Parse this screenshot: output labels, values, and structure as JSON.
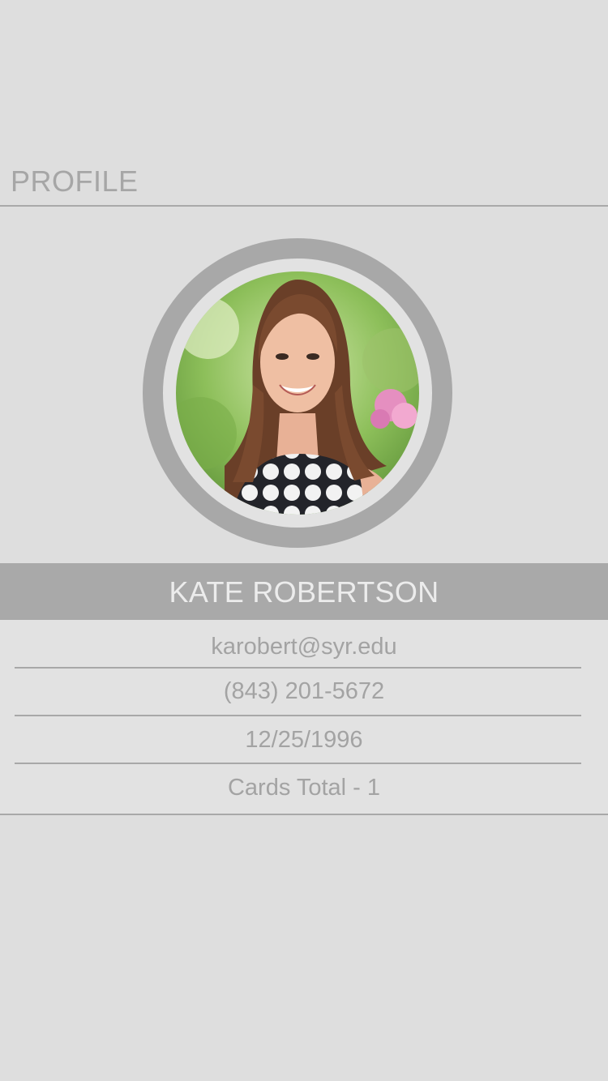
{
  "header": {
    "title": "PROFILE"
  },
  "profile": {
    "name": "KATE ROBERTSON",
    "email": "karobert@syr.edu",
    "phone": "(843) 201-5672",
    "birthdate": "12/25/1996",
    "cards_total": "Cards Total - 1"
  },
  "colors": {
    "background": "#dedede",
    "accent_gray": "#a9a9a9",
    "text_gray": "#a3a3a3",
    "name_text": "#ececec"
  }
}
